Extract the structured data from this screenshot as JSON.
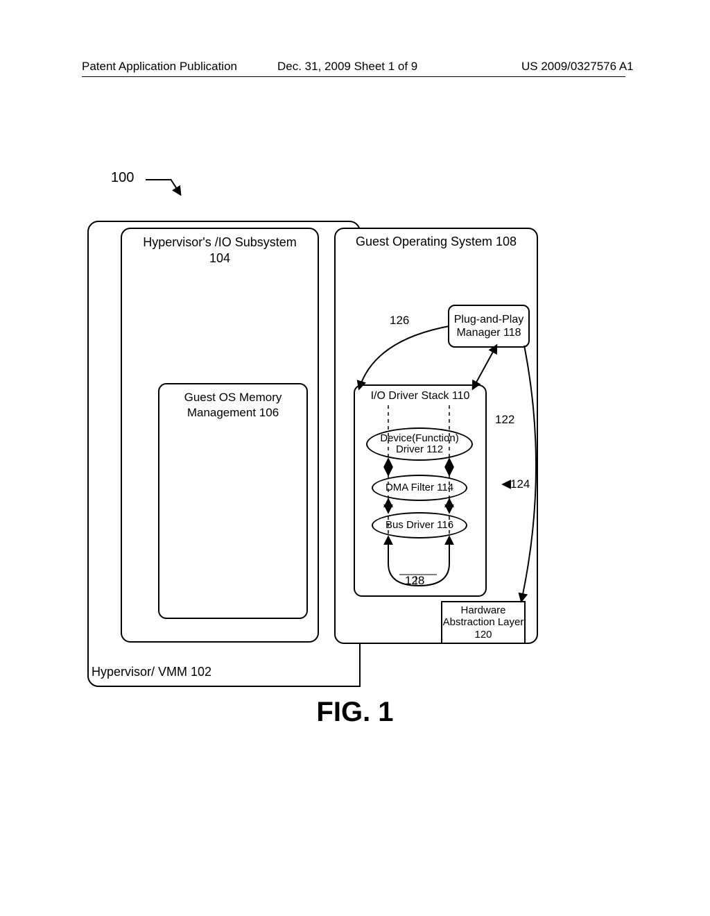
{
  "header": {
    "left": "Patent Application Publication",
    "center": "Dec. 31, 2009  Sheet 1 of 9",
    "right": "US 2009/0327576 A1"
  },
  "figure_ref": "100",
  "hypervisor_label": "Hypervisor/ VMM 102",
  "io_subsystem": {
    "title_line1": "Hypervisor's /IO Subsystem",
    "title_line2": "104"
  },
  "memory_mgmt": {
    "title_line1": "Guest OS Memory",
    "title_line2": "Management 106"
  },
  "guest_os": {
    "title": "Guest Operating System 108"
  },
  "pnp": "Plug-and-Play Manager 118",
  "stack": {
    "title": "I/O Driver Stack 110",
    "device": "Device(Function) Driver 112",
    "dma": "DMA Filter 114",
    "bus": "Bus Driver 116"
  },
  "hal": "Hardware Abstraction Layer 120",
  "refs": {
    "r126": "126",
    "r122": "122",
    "r124": "124",
    "r128": "128"
  },
  "fig_caption": "FIG. 1"
}
